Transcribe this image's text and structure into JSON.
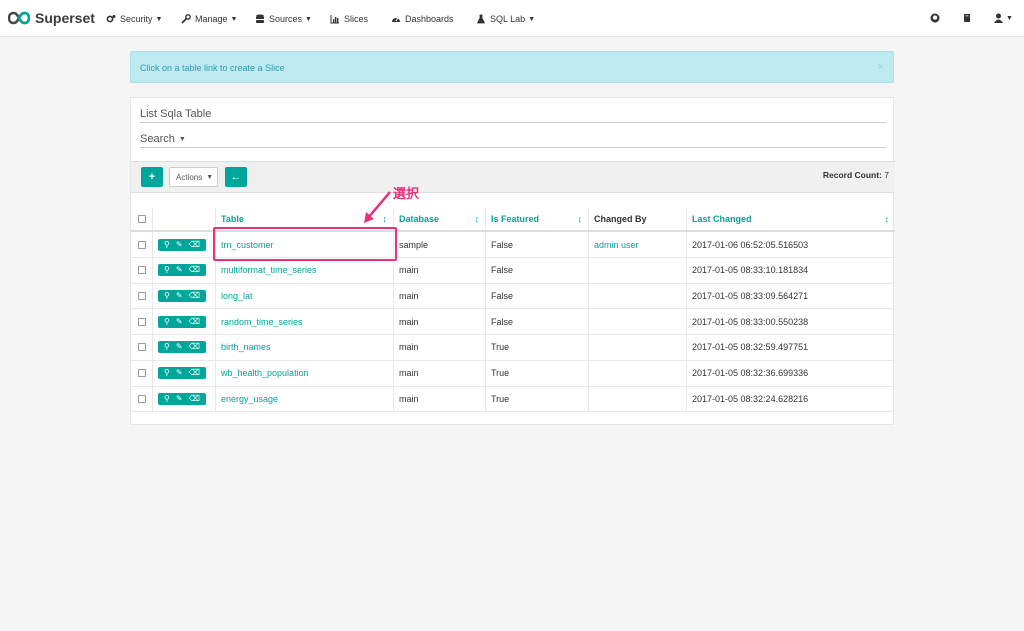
{
  "app": {
    "brand": "Superset",
    "accent_color": "#00a699",
    "annotation_color": "#e8317a"
  },
  "nav": {
    "items": [
      {
        "label": "Security",
        "icon": "gears-icon",
        "dropdown": true
      },
      {
        "label": "Manage",
        "icon": "wrench-icon",
        "dropdown": true
      },
      {
        "label": "Sources",
        "icon": "database-icon",
        "dropdown": true
      },
      {
        "label": "Slices",
        "icon": "bar-chart-icon",
        "dropdown": false
      },
      {
        "label": "Dashboards",
        "icon": "dashboard-icon",
        "dropdown": false
      },
      {
        "label": "SQL Lab",
        "icon": "flask-icon",
        "dropdown": true
      }
    ],
    "right_icons": [
      "github-icon",
      "book-icon",
      "user-icon"
    ]
  },
  "alert": {
    "text": "Click on a table link to create a Slice",
    "close": "×"
  },
  "panel": {
    "title": "List Sqla Table",
    "search_label": "Search"
  },
  "toolbar": {
    "add_label": "+",
    "actions_label": "Actions",
    "back_label": "←",
    "record_count_label": "Record Count:",
    "record_count_value": "7"
  },
  "table": {
    "columns": [
      {
        "label": "",
        "sortable": false
      },
      {
        "label": "",
        "sortable": false
      },
      {
        "label": "Table",
        "sortable": true
      },
      {
        "label": "Database",
        "sortable": true
      },
      {
        "label": "Is Featured",
        "sortable": true
      },
      {
        "label": "Changed By",
        "sortable": false
      },
      {
        "label": "Last Changed",
        "sortable": true
      }
    ],
    "rows": [
      {
        "table": "trn_customer",
        "database": "sample",
        "is_featured": "False",
        "changed_by": "admin user",
        "last_changed": "2017-01-06 06:52:05.516503"
      },
      {
        "table": "multiformat_time_series",
        "database": "main",
        "is_featured": "False",
        "changed_by": "",
        "last_changed": "2017-01-05 08:33:10.181834"
      },
      {
        "table": "long_lat",
        "database": "main",
        "is_featured": "False",
        "changed_by": "",
        "last_changed": "2017-01-05 08:33:09.564271"
      },
      {
        "table": "random_time_series",
        "database": "main",
        "is_featured": "False",
        "changed_by": "",
        "last_changed": "2017-01-05 08:33:00.550238"
      },
      {
        "table": "birth_names",
        "database": "main",
        "is_featured": "True",
        "changed_by": "",
        "last_changed": "2017-01-05 08:32:59.497751"
      },
      {
        "table": "wb_health_population",
        "database": "main",
        "is_featured": "True",
        "changed_by": "",
        "last_changed": "2017-01-05 08:32:36.699336"
      },
      {
        "table": "energy_usage",
        "database": "main",
        "is_featured": "True",
        "changed_by": "",
        "last_changed": "2017-01-05 08:32:24.628216"
      }
    ]
  },
  "annotation": {
    "text": "選択"
  }
}
